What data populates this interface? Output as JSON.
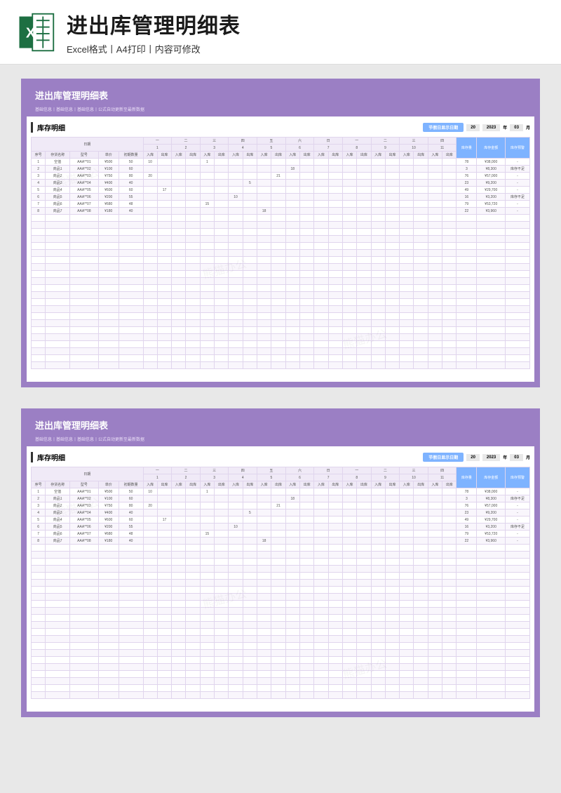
{
  "header": {
    "title": "进出库管理明细表",
    "subtitle": "Excel格式丨A4打印丨内容可修改"
  },
  "sheet": {
    "title": "进出库管理明细表",
    "subtitle": "基础信息丨基础信息丨基础信息丨公式自动更新至最新数据",
    "section": "库存明细",
    "button_label": "节假日显示日期",
    "day_val": "20",
    "year_val": "2023",
    "year_lbl": "年",
    "month_val": "03",
    "month_lbl": "月",
    "date_lbl": "日期",
    "days": [
      "一",
      "二",
      "三",
      "四",
      "五",
      "六",
      "日",
      "一",
      "二",
      "三",
      "四"
    ],
    "nums": [
      "1",
      "2",
      "3",
      "4",
      "5",
      "6",
      "7",
      "8",
      "9",
      "10",
      "11"
    ],
    "head_cols": [
      "序号",
      "存货名称",
      "型号",
      "单价",
      "初期数量"
    ],
    "io": "入库",
    "io2": "出库",
    "blue_cols": [
      "库存量",
      "库存金额",
      "库存预警"
    ],
    "rows": [
      {
        "n": "1",
        "name": "空值",
        "model": "AAA**01",
        "price": "¥500",
        "init": "50",
        "cells": [
          "10",
          "",
          "",
          "",
          "1",
          "",
          "",
          "",
          "",
          "",
          "",
          "",
          "",
          "",
          "",
          "",
          "",
          "",
          "",
          "",
          "",
          ""
        ],
        "stock": "78",
        "amt": "¥38,000",
        "warn": "-"
      },
      {
        "n": "2",
        "name": "商品1",
        "model": "AAA**02",
        "price": "¥100",
        "init": "60",
        "cells": [
          "",
          "",
          "",
          "",
          "",
          "",
          "",
          "",
          "",
          "",
          "18",
          "",
          "",
          "",
          "",
          "",
          "",
          "",
          "",
          "",
          "",
          ""
        ],
        "stock": "3",
        "amt": "¥8,300",
        "warn": "库存不足"
      },
      {
        "n": "3",
        "name": "商品2",
        "model": "AAA**03",
        "price": "¥750",
        "init": "80",
        "cells": [
          "20",
          "",
          "",
          "",
          "",
          "",
          "",
          "",
          "",
          "21",
          "",
          "",
          "",
          "",
          "",
          "",
          "",
          "",
          "",
          "",
          "",
          ""
        ],
        "stock": "76",
        "amt": "¥57,000",
        "warn": "-"
      },
      {
        "n": "4",
        "name": "商品3",
        "model": "AAA**04",
        "price": "¥400",
        "init": "40",
        "cells": [
          "",
          "",
          "",
          "",
          "",
          "",
          "",
          "5",
          "",
          "",
          "",
          "",
          "",
          "",
          "",
          "",
          "",
          "",
          "",
          "",
          "",
          ""
        ],
        "stock": "23",
        "amt": "¥9,200",
        "warn": "-"
      },
      {
        "n": "5",
        "name": "商品4",
        "model": "AAA**05",
        "price": "¥600",
        "init": "60",
        "cells": [
          "",
          "17",
          "",
          "",
          "",
          "",
          "",
          "",
          "",
          "",
          "",
          "",
          "",
          "",
          "",
          "",
          "",
          "",
          "",
          "",
          "",
          ""
        ],
        "stock": "49",
        "amt": "¥29,700",
        "warn": "-"
      },
      {
        "n": "6",
        "name": "商品5",
        "model": "AAA**06",
        "price": "¥200",
        "init": "55",
        "cells": [
          "",
          "",
          "",
          "",
          "",
          "",
          "10",
          "",
          "",
          "",
          "",
          "",
          "",
          "",
          "",
          "",
          "",
          "",
          "",
          "",
          "",
          ""
        ],
        "stock": "16",
        "amt": "¥3,200",
        "warn": "库存不足"
      },
      {
        "n": "7",
        "name": "商品6",
        "model": "AAA**07",
        "price": "¥680",
        "init": "48",
        "cells": [
          "",
          "",
          "",
          "",
          "15",
          "",
          "",
          "",
          "",
          "",
          "",
          "",
          "",
          "",
          "",
          "",
          "",
          "",
          "",
          "",
          "",
          ""
        ],
        "stock": "79",
        "amt": "¥53,720",
        "warn": "-"
      },
      {
        "n": "8",
        "name": "商品7",
        "model": "AAA**08",
        "price": "¥180",
        "init": "40",
        "cells": [
          "",
          "",
          "",
          "",
          "",
          "",
          "",
          "",
          "18",
          "",
          "",
          "",
          "",
          "",
          "",
          "",
          "",
          "",
          "",
          "",
          "",
          ""
        ],
        "stock": "22",
        "amt": "¥3,960",
        "warn": "-"
      }
    ]
  }
}
